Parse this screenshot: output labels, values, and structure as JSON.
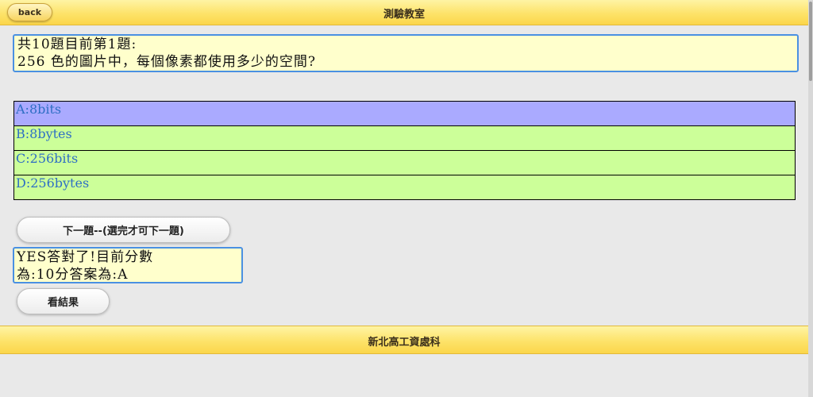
{
  "header": {
    "back_label": "back",
    "title": "測驗教室"
  },
  "question": {
    "line1": "共10題目前第1題:",
    "line2": "256 色的圖片中，每個像素都使用多少的空間?"
  },
  "options": [
    {
      "label": "A:8bits",
      "selected": true
    },
    {
      "label": "B:8bytes",
      "selected": false
    },
    {
      "label": "C:256bits",
      "selected": false
    },
    {
      "label": "D:256bytes",
      "selected": false
    }
  ],
  "next_button_label": "下一題--(選完才可下一題)",
  "result": {
    "line1": "YES答對了!目前分數",
    "line2": "為:10分答案為:A"
  },
  "view_result_label": "看結果",
  "footer": {
    "text": "新北高工資處科"
  },
  "colors": {
    "header_bar": "#fde36a",
    "option_default": "#ccff99",
    "option_selected": "#aaaaff",
    "option_text": "#2f6fc4",
    "box_border": "#4a90e2",
    "box_fill": "#ffffcc"
  }
}
